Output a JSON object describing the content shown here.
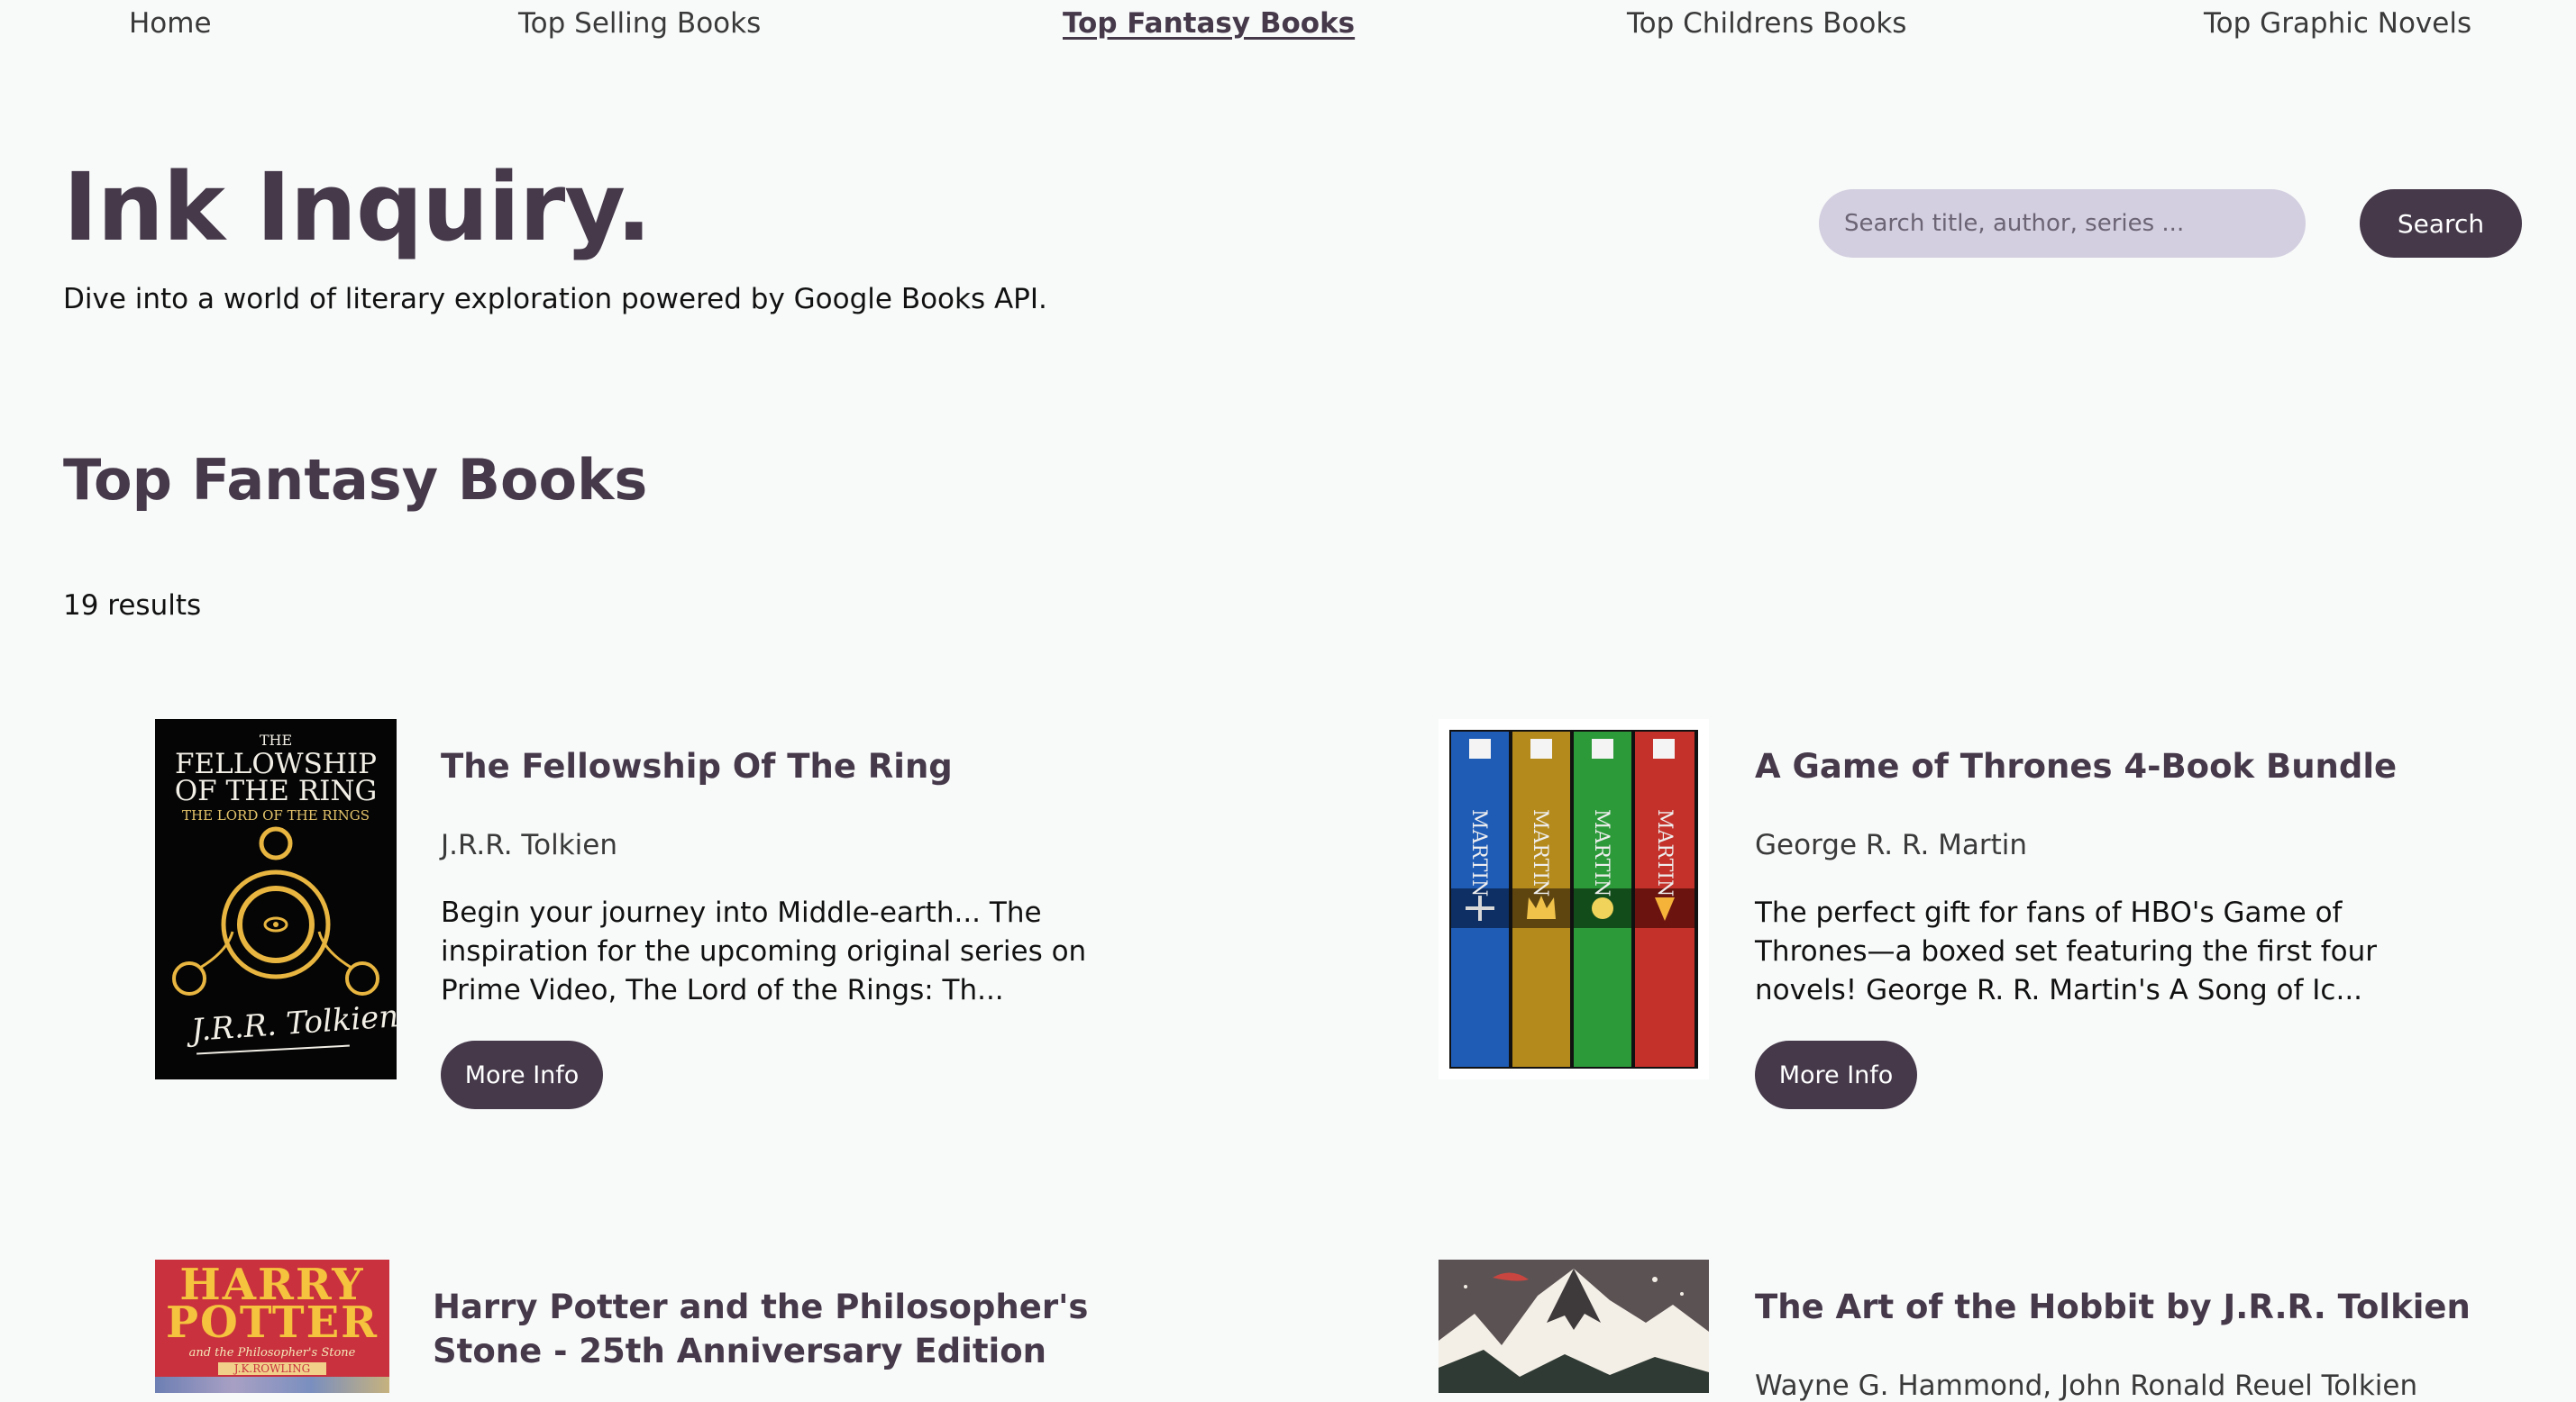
{
  "nav": {
    "items": [
      {
        "label": "Home"
      },
      {
        "label": "Top Selling Books"
      },
      {
        "label": "Top Fantasy Books"
      },
      {
        "label": "Top Childrens Books"
      },
      {
        "label": "Top Graphic Novels"
      }
    ],
    "active": "Top Fantasy Books"
  },
  "header": {
    "brand": "Ink Inquiry.",
    "tagline": "Dive into a world of literary exploration powered by Google Books API.",
    "search_placeholder": "Search title, author, series ...",
    "search_label": "Search"
  },
  "main": {
    "section_title": "Top Fantasy Books",
    "results_text": "19 results",
    "books": [
      {
        "title": "The Fellowship Of The Ring",
        "author": "J.R.R. Tolkien",
        "description": "Begin your journey into Middle-earth... The inspiration for the upcoming original series on Prime Video, The Lord of the Rings: Th...",
        "button": "More Info",
        "cover": {
          "line1": "THE",
          "line2": "FELLOWSHIP",
          "line3": "OF THE RING",
          "line4": "THE LORD OF THE RINGS",
          "signature": "J.R.R. Tolkien"
        }
      },
      {
        "title": "A Game of Thrones 4-Book Bundle",
        "author": "George R. R. Martin",
        "description": "The perfect gift for fans of HBO's Game of Thrones—a boxed set featuring the first four novels! George R. R. Martin's A Song of Ic...",
        "button": "More Info",
        "cover": {
          "spines": [
            "MARTIN",
            "MARTIN",
            "MARTIN",
            "MARTIN"
          ]
        }
      },
      {
        "title": "Harry Potter and the Philosopher's Stone - 25th Anniversary Edition",
        "cover": {
          "line1": "HARRY",
          "line2": "POTTER",
          "subtitle": "and the Philosopher's Stone",
          "author": "J.K.ROWLING"
        }
      },
      {
        "title": "The Art of the Hobbit by J.R.R. Tolkien",
        "author": "Wayne G. Hammond, John Ronald Reuel Tolkien"
      }
    ]
  },
  "colors": {
    "accent": "#45394a",
    "search_bg": "#d3cfe0",
    "page_bg": "#f8f9f9"
  }
}
